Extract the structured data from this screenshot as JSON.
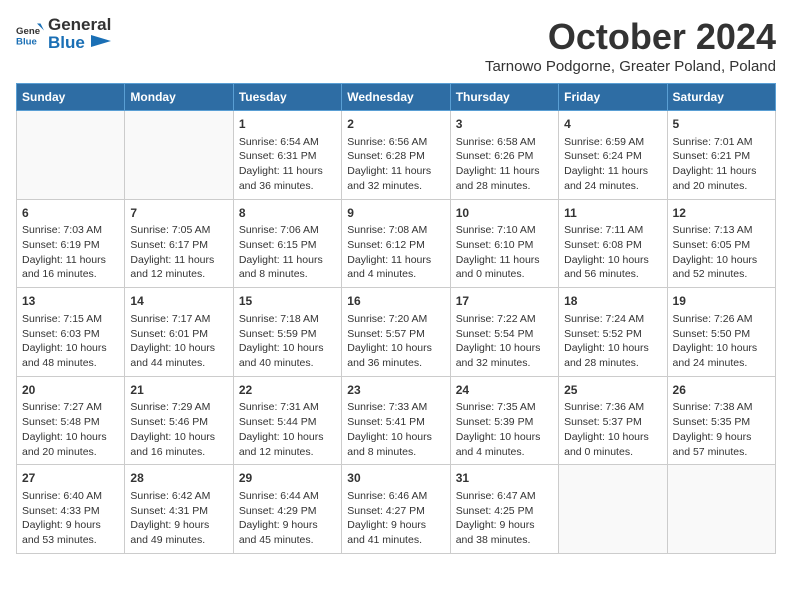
{
  "header": {
    "logo_general": "General",
    "logo_blue": "Blue",
    "title": "October 2024",
    "location": "Tarnowo Podgorne, Greater Poland, Poland"
  },
  "days_of_week": [
    "Sunday",
    "Monday",
    "Tuesday",
    "Wednesday",
    "Thursday",
    "Friday",
    "Saturday"
  ],
  "weeks": [
    [
      {
        "day": "",
        "content": ""
      },
      {
        "day": "",
        "content": ""
      },
      {
        "day": "1",
        "content": "Sunrise: 6:54 AM\nSunset: 6:31 PM\nDaylight: 11 hours and 36 minutes."
      },
      {
        "day": "2",
        "content": "Sunrise: 6:56 AM\nSunset: 6:28 PM\nDaylight: 11 hours and 32 minutes."
      },
      {
        "day": "3",
        "content": "Sunrise: 6:58 AM\nSunset: 6:26 PM\nDaylight: 11 hours and 28 minutes."
      },
      {
        "day": "4",
        "content": "Sunrise: 6:59 AM\nSunset: 6:24 PM\nDaylight: 11 hours and 24 minutes."
      },
      {
        "day": "5",
        "content": "Sunrise: 7:01 AM\nSunset: 6:21 PM\nDaylight: 11 hours and 20 minutes."
      }
    ],
    [
      {
        "day": "6",
        "content": "Sunrise: 7:03 AM\nSunset: 6:19 PM\nDaylight: 11 hours and 16 minutes."
      },
      {
        "day": "7",
        "content": "Sunrise: 7:05 AM\nSunset: 6:17 PM\nDaylight: 11 hours and 12 minutes."
      },
      {
        "day": "8",
        "content": "Sunrise: 7:06 AM\nSunset: 6:15 PM\nDaylight: 11 hours and 8 minutes."
      },
      {
        "day": "9",
        "content": "Sunrise: 7:08 AM\nSunset: 6:12 PM\nDaylight: 11 hours and 4 minutes."
      },
      {
        "day": "10",
        "content": "Sunrise: 7:10 AM\nSunset: 6:10 PM\nDaylight: 11 hours and 0 minutes."
      },
      {
        "day": "11",
        "content": "Sunrise: 7:11 AM\nSunset: 6:08 PM\nDaylight: 10 hours and 56 minutes."
      },
      {
        "day": "12",
        "content": "Sunrise: 7:13 AM\nSunset: 6:05 PM\nDaylight: 10 hours and 52 minutes."
      }
    ],
    [
      {
        "day": "13",
        "content": "Sunrise: 7:15 AM\nSunset: 6:03 PM\nDaylight: 10 hours and 48 minutes."
      },
      {
        "day": "14",
        "content": "Sunrise: 7:17 AM\nSunset: 6:01 PM\nDaylight: 10 hours and 44 minutes."
      },
      {
        "day": "15",
        "content": "Sunrise: 7:18 AM\nSunset: 5:59 PM\nDaylight: 10 hours and 40 minutes."
      },
      {
        "day": "16",
        "content": "Sunrise: 7:20 AM\nSunset: 5:57 PM\nDaylight: 10 hours and 36 minutes."
      },
      {
        "day": "17",
        "content": "Sunrise: 7:22 AM\nSunset: 5:54 PM\nDaylight: 10 hours and 32 minutes."
      },
      {
        "day": "18",
        "content": "Sunrise: 7:24 AM\nSunset: 5:52 PM\nDaylight: 10 hours and 28 minutes."
      },
      {
        "day": "19",
        "content": "Sunrise: 7:26 AM\nSunset: 5:50 PM\nDaylight: 10 hours and 24 minutes."
      }
    ],
    [
      {
        "day": "20",
        "content": "Sunrise: 7:27 AM\nSunset: 5:48 PM\nDaylight: 10 hours and 20 minutes."
      },
      {
        "day": "21",
        "content": "Sunrise: 7:29 AM\nSunset: 5:46 PM\nDaylight: 10 hours and 16 minutes."
      },
      {
        "day": "22",
        "content": "Sunrise: 7:31 AM\nSunset: 5:44 PM\nDaylight: 10 hours and 12 minutes."
      },
      {
        "day": "23",
        "content": "Sunrise: 7:33 AM\nSunset: 5:41 PM\nDaylight: 10 hours and 8 minutes."
      },
      {
        "day": "24",
        "content": "Sunrise: 7:35 AM\nSunset: 5:39 PM\nDaylight: 10 hours and 4 minutes."
      },
      {
        "day": "25",
        "content": "Sunrise: 7:36 AM\nSunset: 5:37 PM\nDaylight: 10 hours and 0 minutes."
      },
      {
        "day": "26",
        "content": "Sunrise: 7:38 AM\nSunset: 5:35 PM\nDaylight: 9 hours and 57 minutes."
      }
    ],
    [
      {
        "day": "27",
        "content": "Sunrise: 6:40 AM\nSunset: 4:33 PM\nDaylight: 9 hours and 53 minutes."
      },
      {
        "day": "28",
        "content": "Sunrise: 6:42 AM\nSunset: 4:31 PM\nDaylight: 9 hours and 49 minutes."
      },
      {
        "day": "29",
        "content": "Sunrise: 6:44 AM\nSunset: 4:29 PM\nDaylight: 9 hours and 45 minutes."
      },
      {
        "day": "30",
        "content": "Sunrise: 6:46 AM\nSunset: 4:27 PM\nDaylight: 9 hours and 41 minutes."
      },
      {
        "day": "31",
        "content": "Sunrise: 6:47 AM\nSunset: 4:25 PM\nDaylight: 9 hours and 38 minutes."
      },
      {
        "day": "",
        "content": ""
      },
      {
        "day": "",
        "content": ""
      }
    ]
  ]
}
